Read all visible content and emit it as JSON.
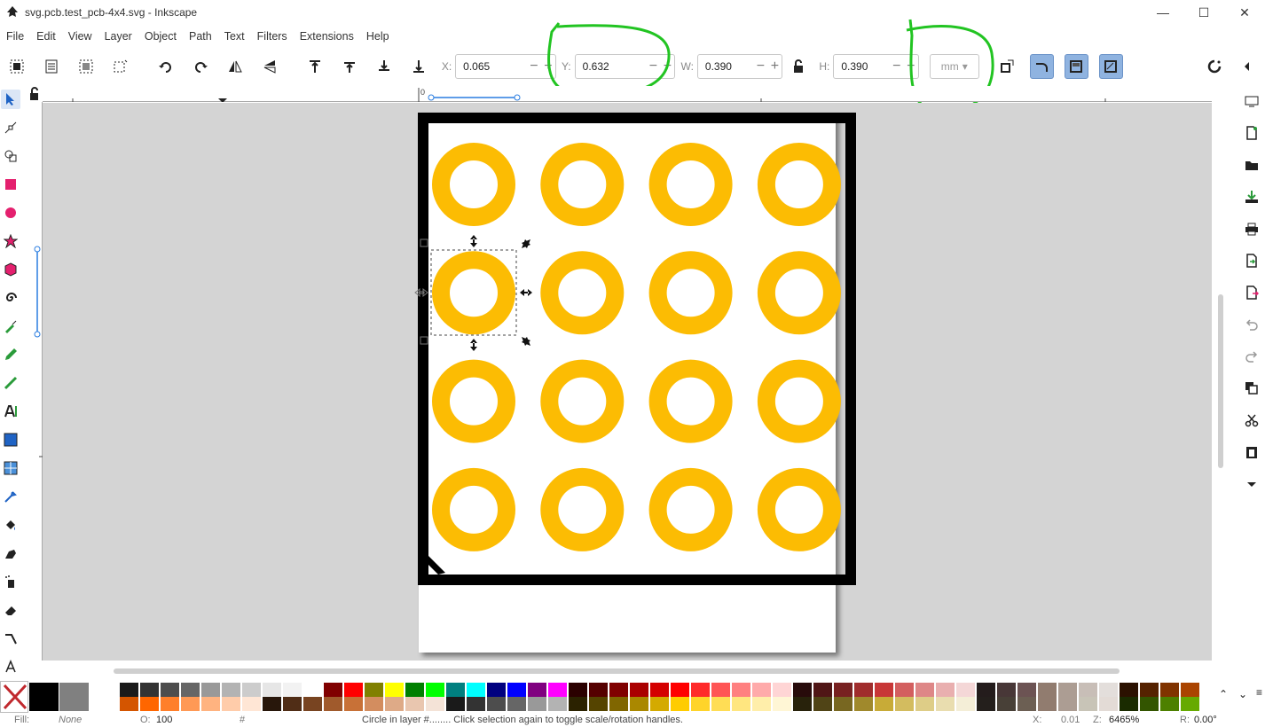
{
  "window": {
    "title": "svg.pcb.test_pcb-4x4.svg - Inkscape",
    "controls": {
      "minimize": "—",
      "maximize": "☐",
      "close": "✕"
    }
  },
  "menu": [
    "File",
    "Edit",
    "View",
    "Layer",
    "Object",
    "Path",
    "Text",
    "Filters",
    "Extensions",
    "Help"
  ],
  "toolbar": {
    "x_label": "X:",
    "x_value": "0.065",
    "y_label": "Y:",
    "y_value": "0.632",
    "w_label": "W:",
    "w_value": "0.390",
    "h_label": "H:",
    "h_value": "0.390",
    "unit": "mm",
    "minus": "−",
    "plus": "+"
  },
  "ruler": {
    "origin_label": "0"
  },
  "document": {
    "pad_color": "#fcbc03",
    "border_color": "#000000",
    "pad_grid": {
      "rows": 4,
      "cols": 4
    },
    "selected_pad": {
      "row": 2,
      "col": 1
    }
  },
  "annotations": {
    "color": "#22c422"
  },
  "status": {
    "fill_label": "Fill:",
    "fill_value": "None",
    "opacity_label": "O:",
    "opacity_value": "100",
    "layer_value": "#",
    "message": "Circle in layer #........ Click selection again to toggle scale/rotation handles.",
    "x_label": "X:",
    "x_value": "0.01",
    "zoom_label": "Z:",
    "zoom_value": "6465%",
    "rotation_label": "R:",
    "rotation_value": "0.00°"
  },
  "palette": {
    "colors_row1": [
      "#1a1a1a",
      "#333333",
      "#4d4d4d",
      "#666666",
      "#999999",
      "#b3b3b3",
      "#cccccc",
      "#e6e6e6",
      "#f2f2f2",
      "#ffffff",
      "#800000",
      "#ff0000",
      "#808000",
      "#ffff00",
      "#008000",
      "#00ff00",
      "#008080",
      "#00ffff",
      "#000080",
      "#0000ff",
      "#800080",
      "#ff00ff",
      "#2b0000",
      "#550000",
      "#800000",
      "#aa0000",
      "#d40000",
      "#ff0000",
      "#ff2a2a",
      "#ff5555",
      "#ff8080",
      "#ffaaaa",
      "#ffd5d5",
      "#280b0b",
      "#501616",
      "#782121",
      "#a02c2c",
      "#c83737",
      "#d35f5f",
      "#de8787",
      "#e9afaf",
      "#f4d7d7",
      "#241c1c",
      "#483737",
      "#6c5353",
      "#917c6f",
      "#ac9d93",
      "#c8beb7",
      "#e3dedb",
      "#2b1100",
      "#552200",
      "#803300",
      "#aa4400"
    ],
    "colors_row2": [
      "#d45500",
      "#ff6600",
      "#ff7f2a",
      "#ff9955",
      "#ffb380",
      "#ffccaa",
      "#ffe6d5",
      "#28170b",
      "#502d16",
      "#784421",
      "#a05a2c",
      "#c87137",
      "#d38d5f",
      "#deaa87",
      "#e9c6af",
      "#f4e3d7",
      "#1a1a1a",
      "#333333",
      "#4d4d4d",
      "#666666",
      "#999999",
      "#b3b3b3",
      "#2b2200",
      "#554400",
      "#806600",
      "#aa8800",
      "#d4aa00",
      "#ffcc00",
      "#ffd42a",
      "#ffdd55",
      "#ffe680",
      "#ffeeaa",
      "#fff6d5",
      "#28220b",
      "#504416",
      "#786721",
      "#a0892c",
      "#c8ab37",
      "#d3bc5f",
      "#decd87",
      "#e9ddaf",
      "#f4eed7",
      "#241f1c",
      "#484037",
      "#6c5f53",
      "#917c6f",
      "#ac9d93",
      "#c8c4b7",
      "#e3dbd6",
      "#1a2b00",
      "#335500",
      "#4d8000",
      "#66aa00"
    ]
  }
}
